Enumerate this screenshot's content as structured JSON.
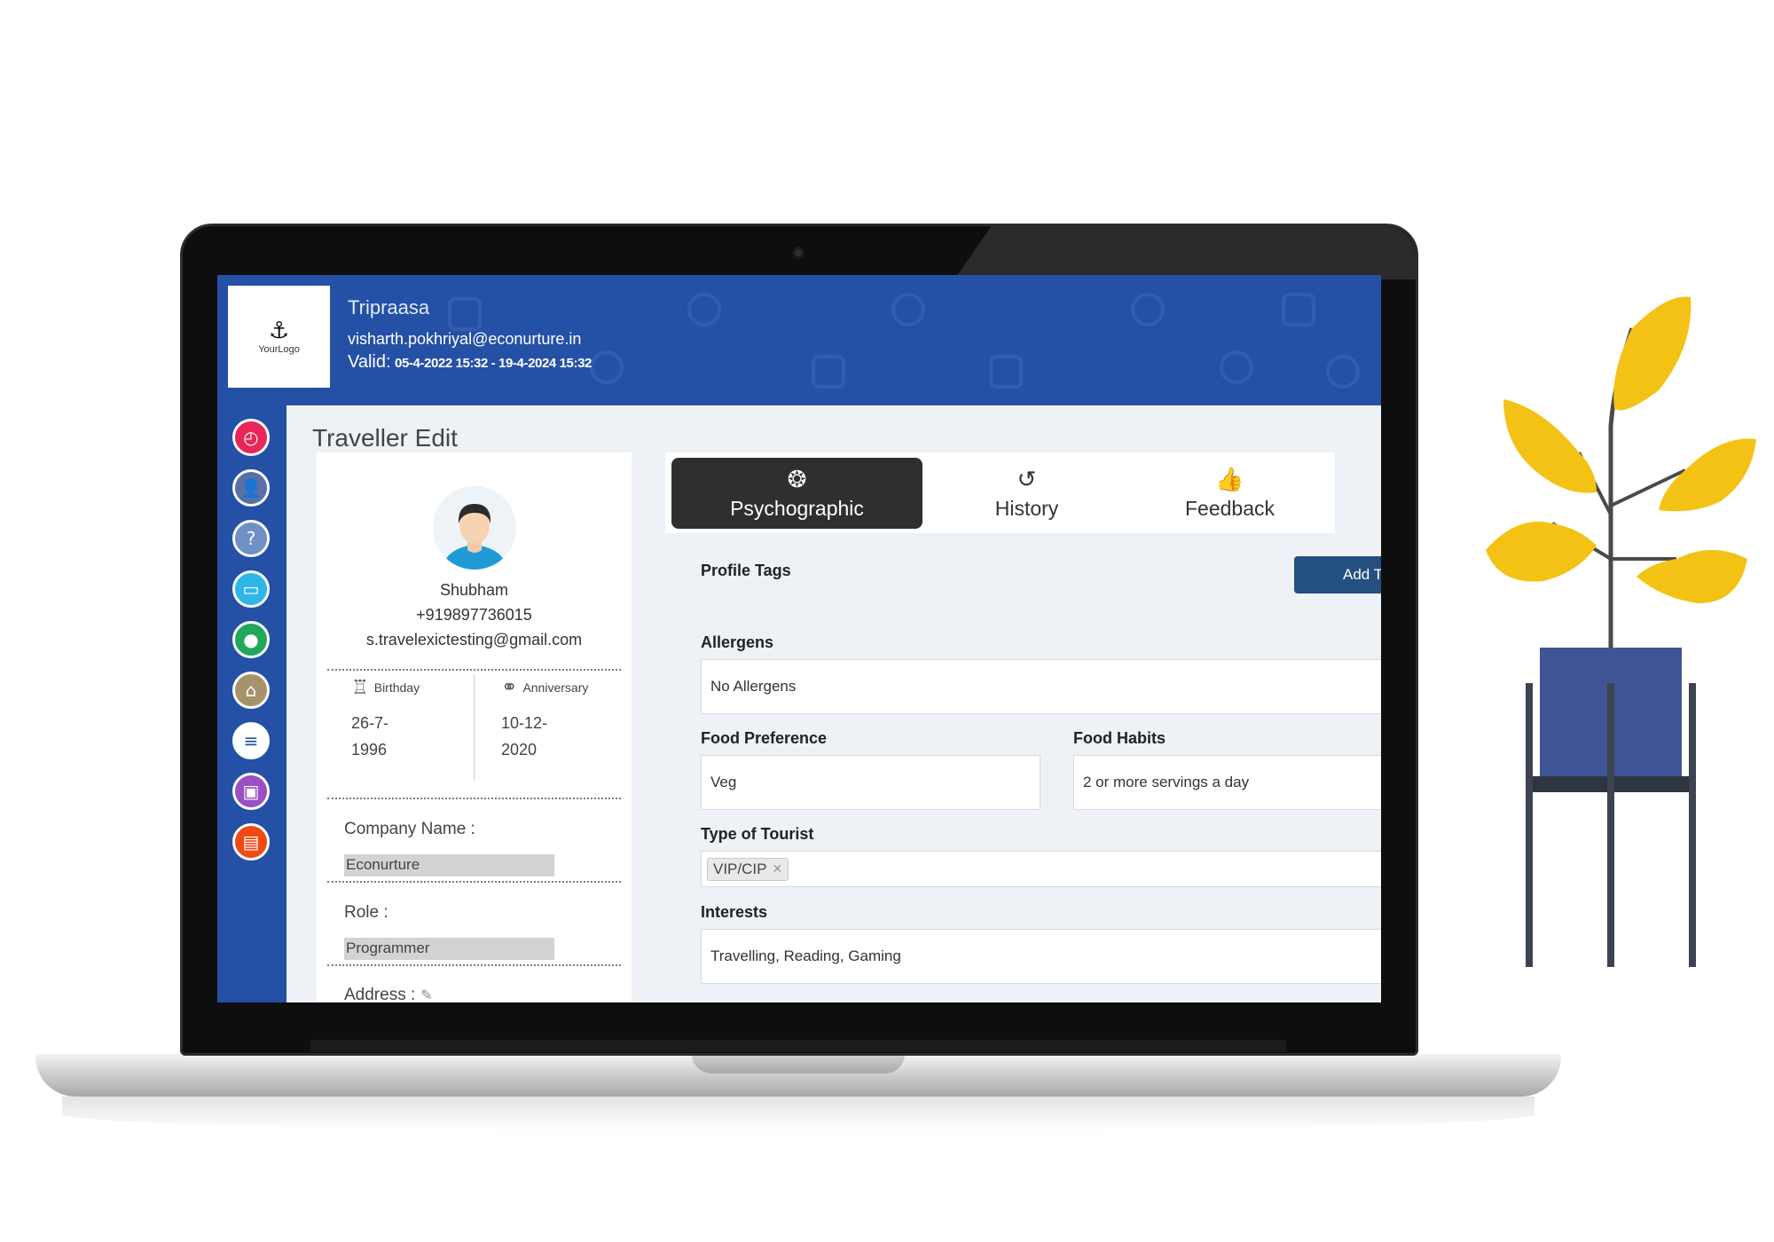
{
  "header": {
    "logo_text": "YourLogo",
    "org_name": "Tripraasa",
    "email": "visharth.pokhriyal@econurture.in",
    "valid_label": "Valid:",
    "valid_range": "05-4-2022 15:32 - 19-4-2024 15:32"
  },
  "sidebar": {
    "items": [
      {
        "icon": "dashboard-gauge-icon",
        "color": "#e8265a"
      },
      {
        "icon": "user-settings-icon",
        "color": "#5a6fa6"
      },
      {
        "icon": "help-document-icon",
        "color": "#6f8fc7"
      },
      {
        "icon": "booking-screen-icon",
        "color": "#2fb6e8"
      },
      {
        "icon": "group-users-icon",
        "color": "#21a85b"
      },
      {
        "icon": "hotel-bed-icon",
        "color": "#a8926a"
      },
      {
        "icon": "search-list-icon",
        "color": "#ffffff"
      },
      {
        "icon": "gift-icon",
        "color": "#9a4fc4"
      },
      {
        "icon": "briefcase-icon",
        "color": "#f04a14"
      }
    ]
  },
  "page": {
    "title": "Traveller Edit"
  },
  "profile": {
    "name": "Shubham",
    "phone": "+919897736015",
    "email": "s.travelexictesting@gmail.com",
    "birthday_label": "Birthday",
    "birthday": "26-7-1996",
    "anniversary_label": "Anniversary",
    "anniversary": "10-12-2020",
    "company_label": "Company Name :",
    "company": "Econurture",
    "role_label": "Role :",
    "role": "Programmer",
    "address_label": "Address :"
  },
  "tabs": [
    {
      "label": "Psychographic",
      "icon": "brain-icon",
      "active": true
    },
    {
      "label": "History",
      "icon": "history-icon",
      "active": false
    },
    {
      "label": "Feedback",
      "icon": "thumbs-up-icon",
      "active": false
    }
  ],
  "form": {
    "profile_tags_label": "Profile Tags",
    "add_tag_button": "Add Ta",
    "allergens_label": "Allergens",
    "allergens_value": "No Allergens",
    "food_pref_label": "Food Preference",
    "food_pref_value": "Veg",
    "food_habits_label": "Food Habits",
    "food_habits_value": "2 or more servings a day",
    "tourist_type_label": "Type of Tourist",
    "tourist_type_tag": "VIP/CIP",
    "interests_label": "Interests",
    "interests_value": "Travelling, Reading, Gaming"
  },
  "colors": {
    "header_bg": "#2451a6",
    "active_tab_bg": "#2f2f2f",
    "add_button_bg": "#24507f",
    "plant_leaf": "#f3c214",
    "plant_pot": "#3e5494"
  }
}
